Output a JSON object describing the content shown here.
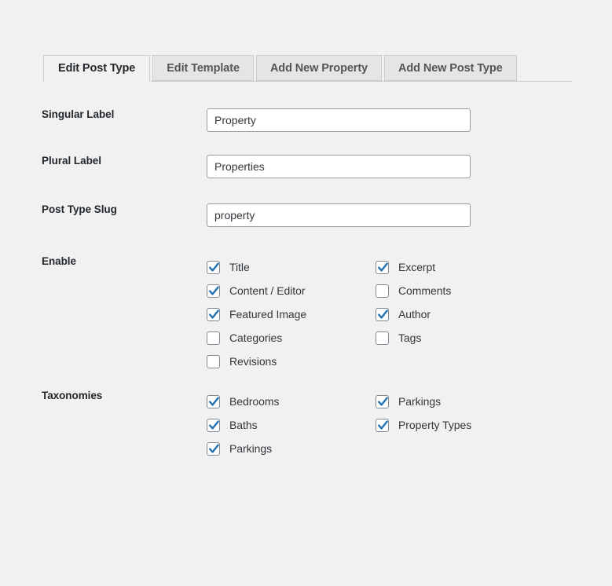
{
  "tabs": [
    {
      "label": "Edit Post Type",
      "active": true
    },
    {
      "label": "Edit Template",
      "active": false
    },
    {
      "label": "Add New Property",
      "active": false
    },
    {
      "label": "Add New Post Type",
      "active": false
    }
  ],
  "fields": [
    {
      "label": "Singular Label",
      "value": "Property",
      "placeholder": ""
    },
    {
      "label": "Plural Label",
      "value": "Properties",
      "placeholder": ""
    },
    {
      "label": "Post Type Slug",
      "value": "property",
      "placeholder": ""
    }
  ],
  "enable": {
    "label": "Enable",
    "column_1": [
      {
        "label": "Title",
        "checked": true
      },
      {
        "label": "Content / Editor",
        "checked": true
      },
      {
        "label": "Featured Image",
        "checked": true
      },
      {
        "label": "Categories",
        "checked": false
      },
      {
        "label": "Revisions",
        "checked": false
      }
    ],
    "column_2": [
      {
        "label": "Excerpt",
        "checked": true
      },
      {
        "label": "Comments",
        "checked": false
      },
      {
        "label": "Author",
        "checked": true
      },
      {
        "label": "Tags",
        "checked": false
      }
    ]
  },
  "taxonomies": {
    "label": "Taxonomies",
    "column_1": [
      {
        "label": "Bedrooms",
        "checked": true
      },
      {
        "label": "Baths",
        "checked": true
      },
      {
        "label": "Parkings",
        "checked": true
      }
    ],
    "column_2": [
      {
        "label": "Parkings",
        "checked": true
      },
      {
        "label": "Property Types",
        "checked": true
      }
    ]
  },
  "colors": {
    "page_background": "#f1f1f1",
    "tab_inactive": "#e5e5e5",
    "tab_active": "#f1f1f1",
    "border": "#cccccc",
    "check_accent": "#2271b1",
    "text": "#32373c"
  }
}
